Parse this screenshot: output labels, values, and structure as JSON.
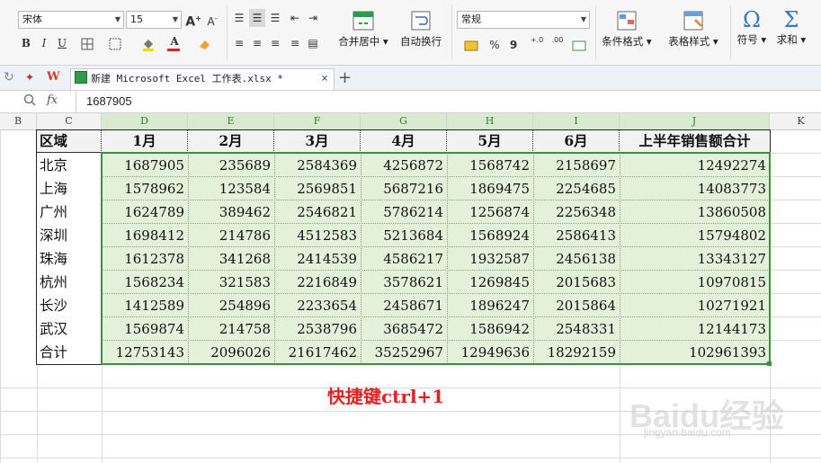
{
  "ribbon": {
    "font_name": "宋体",
    "font_size": "15",
    "number_format": "常规",
    "merge_label": "合并居中",
    "wrap_label": "自动换行",
    "cond_format_label": "条件格式",
    "table_style_label": "表格样式",
    "symbol_label": "符号",
    "sum_label": "求和",
    "bold": "B",
    "italic": "I",
    "underline": "U",
    "font_color_letter": "A",
    "percent": "%",
    "comma": "9",
    "inc_dec": "+.0",
    "dec_dec": ".00",
    "omega": "Ω",
    "sigma": "Σ"
  },
  "tabbar": {
    "file_tab": "新建 Microsoft Excel 工作表.xlsx *",
    "close": "×",
    "add": "+"
  },
  "formula_bar": {
    "fx": "fx",
    "value": "1687905"
  },
  "grid": {
    "columns": [
      "B",
      "C",
      "D",
      "E",
      "F",
      "G",
      "H",
      "I",
      "J",
      "K"
    ],
    "header_row": [
      "区域",
      "1月",
      "2月",
      "3月",
      "4月",
      "5月",
      "6月",
      "上半年销售额合计"
    ],
    "rows": [
      {
        "region": "北京",
        "values": [
          "1687905",
          "235689",
          "2584369",
          "4256872",
          "1568742",
          "2158697",
          "12492274"
        ]
      },
      {
        "region": "上海",
        "values": [
          "1578962",
          "123584",
          "2569851",
          "5687216",
          "1869475",
          "2254685",
          "14083773"
        ]
      },
      {
        "region": "广州",
        "values": [
          "1624789",
          "389462",
          "2546821",
          "5786214",
          "1256874",
          "2256348",
          "13860508"
        ]
      },
      {
        "region": "深圳",
        "values": [
          "1698412",
          "214786",
          "4512583",
          "5213684",
          "1568924",
          "2586413",
          "15794802"
        ]
      },
      {
        "region": "珠海",
        "values": [
          "1612378",
          "341268",
          "2414539",
          "4586217",
          "1932587",
          "2456138",
          "13343127"
        ]
      },
      {
        "region": "杭州",
        "values": [
          "1568234",
          "321583",
          "2216849",
          "3578621",
          "1269845",
          "2015683",
          "10970815"
        ]
      },
      {
        "region": "长沙",
        "values": [
          "1412589",
          "254896",
          "2233654",
          "2458671",
          "1896247",
          "2015864",
          "10271921"
        ]
      },
      {
        "region": "武汉",
        "values": [
          "1569874",
          "214758",
          "2538796",
          "3685472",
          "1586942",
          "2548331",
          "12144173"
        ]
      },
      {
        "region": "合计",
        "values": [
          "12753143",
          "2096026",
          "21617462",
          "35252967",
          "12949636",
          "18292159",
          "102961393"
        ]
      }
    ]
  },
  "annotation": "快捷键ctrl+1",
  "watermark": {
    "brand": "Baidu经验",
    "url": "jingyan.baidu.com"
  },
  "colors": {
    "selection_fill": "#e3f1da",
    "selection_border": "#3c8f3c",
    "note": "#e02222"
  }
}
